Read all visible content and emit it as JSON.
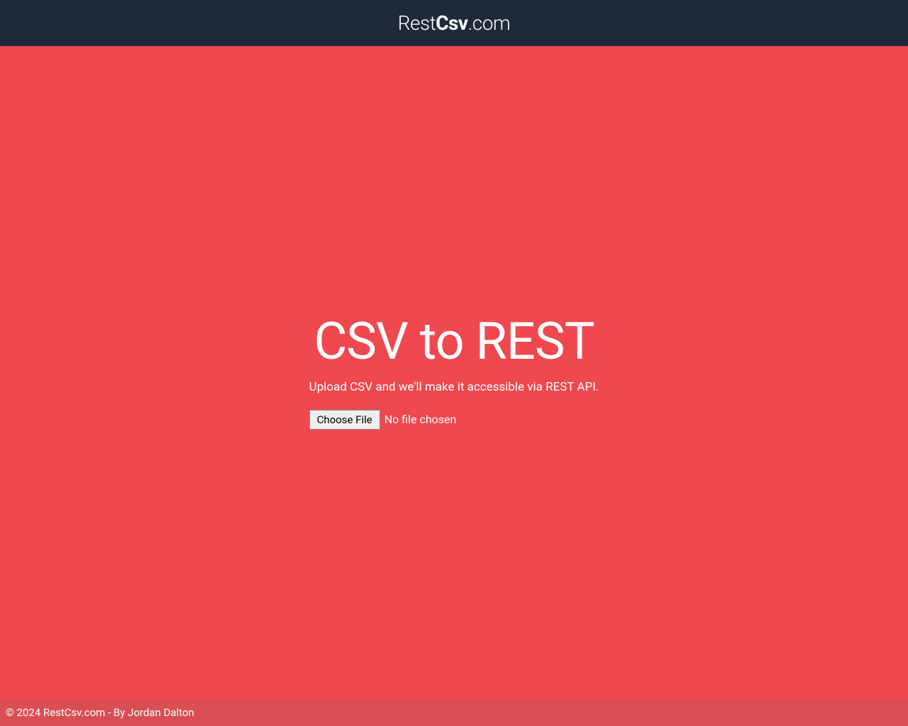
{
  "header": {
    "logo_rest": "Rest",
    "logo_csv": "Csv",
    "logo_com": ".com"
  },
  "main": {
    "title": "CSV to REST",
    "subtitle": "Upload CSV and we'll make it accessible via REST API.",
    "choose_file_label": "Choose File",
    "file_status": "No file chosen"
  },
  "footer": {
    "copyright_prefix": "© 2024 RestCsv.com - By ",
    "author": "Jordan Dalton"
  }
}
